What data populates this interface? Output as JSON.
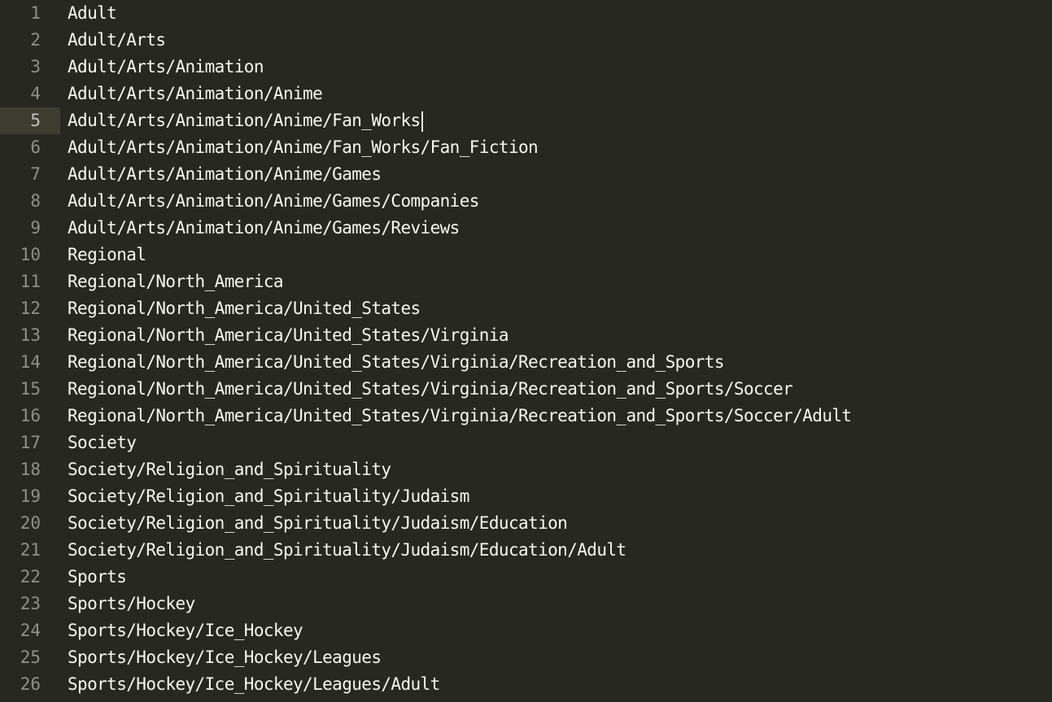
{
  "editor": {
    "active_line": 5,
    "lines": [
      {
        "number": "1",
        "text": "Adult"
      },
      {
        "number": "2",
        "text": "Adult/Arts"
      },
      {
        "number": "3",
        "text": "Adult/Arts/Animation"
      },
      {
        "number": "4",
        "text": "Adult/Arts/Animation/Anime"
      },
      {
        "number": "5",
        "text": "Adult/Arts/Animation/Anime/Fan_Works"
      },
      {
        "number": "6",
        "text": "Adult/Arts/Animation/Anime/Fan_Works/Fan_Fiction"
      },
      {
        "number": "7",
        "text": "Adult/Arts/Animation/Anime/Games"
      },
      {
        "number": "8",
        "text": "Adult/Arts/Animation/Anime/Games/Companies"
      },
      {
        "number": "9",
        "text": "Adult/Arts/Animation/Anime/Games/Reviews"
      },
      {
        "number": "10",
        "text": "Regional"
      },
      {
        "number": "11",
        "text": "Regional/North_America"
      },
      {
        "number": "12",
        "text": "Regional/North_America/United_States"
      },
      {
        "number": "13",
        "text": "Regional/North_America/United_States/Virginia"
      },
      {
        "number": "14",
        "text": "Regional/North_America/United_States/Virginia/Recreation_and_Sports"
      },
      {
        "number": "15",
        "text": "Regional/North_America/United_States/Virginia/Recreation_and_Sports/Soccer"
      },
      {
        "number": "16",
        "text": "Regional/North_America/United_States/Virginia/Recreation_and_Sports/Soccer/Adult"
      },
      {
        "number": "17",
        "text": "Society"
      },
      {
        "number": "18",
        "text": "Society/Religion_and_Spirituality"
      },
      {
        "number": "19",
        "text": "Society/Religion_and_Spirituality/Judaism"
      },
      {
        "number": "20",
        "text": "Society/Religion_and_Spirituality/Judaism/Education"
      },
      {
        "number": "21",
        "text": "Society/Religion_and_Spirituality/Judaism/Education/Adult"
      },
      {
        "number": "22",
        "text": "Sports"
      },
      {
        "number": "23",
        "text": "Sports/Hockey"
      },
      {
        "number": "24",
        "text": "Sports/Hockey/Ice_Hockey"
      },
      {
        "number": "25",
        "text": "Sports/Hockey/Ice_Hockey/Leagues"
      },
      {
        "number": "26",
        "text": "Sports/Hockey/Ice_Hockey/Leagues/Adult"
      }
    ]
  }
}
